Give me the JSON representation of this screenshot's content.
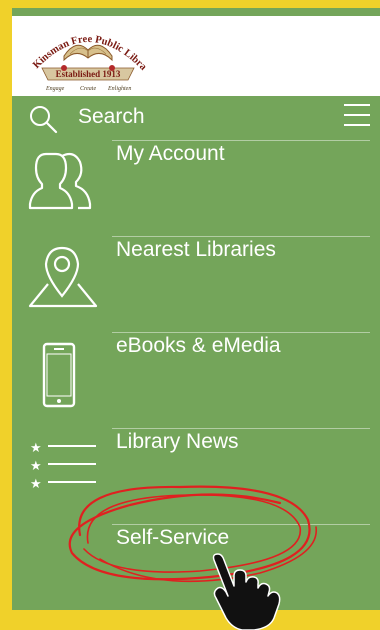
{
  "header": {
    "logo": {
      "name": "Kinsman Free Public Library",
      "established": "Established 1913",
      "tagline_1": "Engage",
      "tagline_2": "Create",
      "tagline_3": "Enlighten"
    }
  },
  "search": {
    "label": "Search"
  },
  "menu": {
    "items": [
      {
        "label": "My Account",
        "icon": "people-icon"
      },
      {
        "label": "Nearest Libraries",
        "icon": "map-pin-icon"
      },
      {
        "label": "eBooks & eMedia",
        "icon": "phone-icon"
      },
      {
        "label": "Library News",
        "icon": "star-list-icon"
      },
      {
        "label": "Self-Service",
        "icon": "none"
      }
    ]
  },
  "colors": {
    "frame": "#f0d12a",
    "app_background": "#74a55a",
    "header_background": "#ffffff",
    "text": "#ffffff",
    "highlight_circle": "#e02020",
    "pointer_hand": "#111111"
  }
}
